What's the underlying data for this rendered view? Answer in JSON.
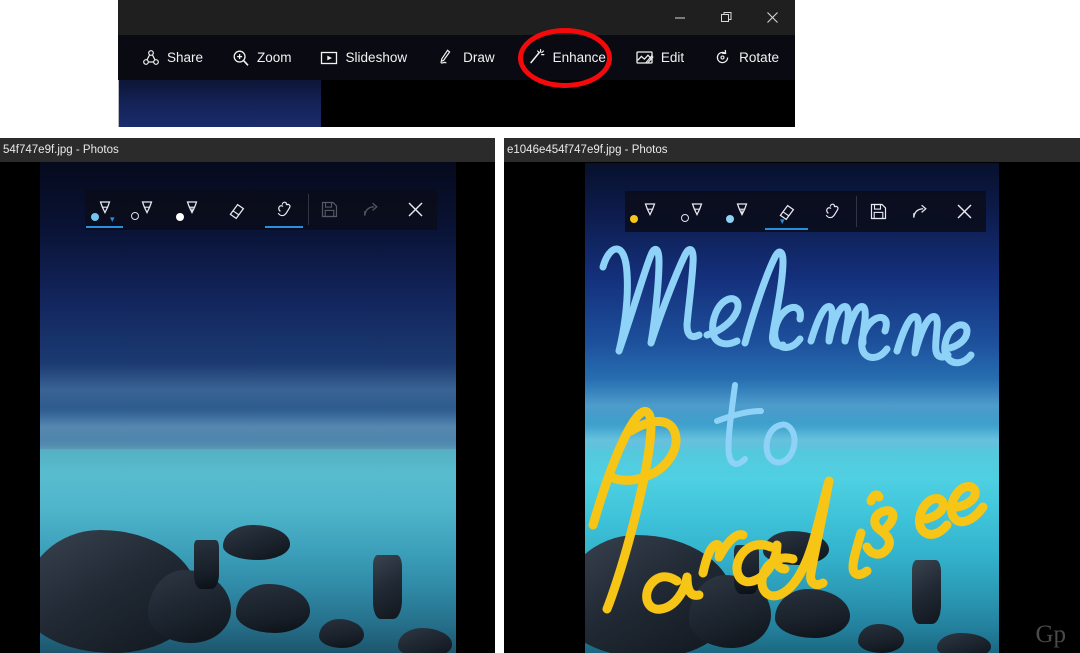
{
  "top_window": {
    "window_controls": [
      {
        "name": "minimize",
        "glyph": "minimize-icon"
      },
      {
        "name": "restore",
        "glyph": "restore-icon"
      },
      {
        "name": "close",
        "glyph": "close-icon"
      }
    ],
    "toolbar": [
      {
        "label": "Share",
        "icon": "share-icon"
      },
      {
        "label": "Zoom",
        "icon": "magnifier-plus-icon"
      },
      {
        "label": "Slideshow",
        "icon": "slideshow-icon"
      },
      {
        "label": "Draw",
        "icon": "pen-icon",
        "highlighted": true
      },
      {
        "label": "Enhance",
        "icon": "magic-wand-icon"
      },
      {
        "label": "Edit",
        "icon": "edit-image-icon"
      },
      {
        "label": "Rotate",
        "icon": "rotate-icon"
      }
    ],
    "overflow_label": "···",
    "annotation_color": "#f40a0a"
  },
  "left_window": {
    "title": "54f747e9f.jpg - Photos",
    "ink_tools": [
      {
        "name": "ballpoint-pen",
        "dot_color": "#6fc6f0",
        "selected": true,
        "has_chevron": true
      },
      {
        "name": "pencil",
        "dot_color": "hollow",
        "selected": false,
        "has_chevron": false
      },
      {
        "name": "calligraphy-pen",
        "dot_color": "#ffffff",
        "selected": false,
        "has_chevron": false
      },
      {
        "name": "eraser",
        "dot_color": null,
        "selected": false,
        "has_chevron": false
      },
      {
        "name": "touch-writing",
        "dot_color": null,
        "selected": true,
        "has_chevron": false
      }
    ],
    "action_tools": [
      {
        "name": "save-button",
        "enabled": false
      },
      {
        "name": "share-button",
        "enabled": false
      },
      {
        "name": "close-button",
        "enabled": true
      }
    ],
    "photo": {
      "alt": "seascape-rocks-dusk",
      "variant": "dark"
    },
    "ink_strokes": []
  },
  "right_window": {
    "title": "e1046e454f747e9f.jpg - Photos",
    "ink_tools": [
      {
        "name": "ballpoint-pen",
        "dot_color": "#f5c518",
        "selected": false,
        "has_chevron": false
      },
      {
        "name": "pencil",
        "dot_color": "hollow",
        "selected": false,
        "has_chevron": false
      },
      {
        "name": "calligraphy-pen",
        "dot_color": "#8fd3f4",
        "selected": false,
        "has_chevron": false
      },
      {
        "name": "eraser",
        "dot_color": null,
        "selected": true,
        "has_chevron": true
      },
      {
        "name": "touch-writing",
        "dot_color": null,
        "selected": false,
        "has_chevron": false
      }
    ],
    "action_tools": [
      {
        "name": "save-button",
        "enabled": true
      },
      {
        "name": "share-button",
        "enabled": true
      },
      {
        "name": "close-button",
        "enabled": true
      }
    ],
    "photo": {
      "alt": "seascape-rocks-daylight",
      "variant": "bright"
    },
    "ink_strokes": [
      {
        "text": "Welcome",
        "color": "#8ed3f7",
        "style": "cursive-handwriting"
      },
      {
        "text": "to",
        "color": "#8ed3f7",
        "style": "cursive-handwriting"
      },
      {
        "text": "Paradise",
        "color": "#f7c515",
        "style": "cursive-handwriting"
      }
    ]
  },
  "watermark": {
    "text": "Gp"
  }
}
